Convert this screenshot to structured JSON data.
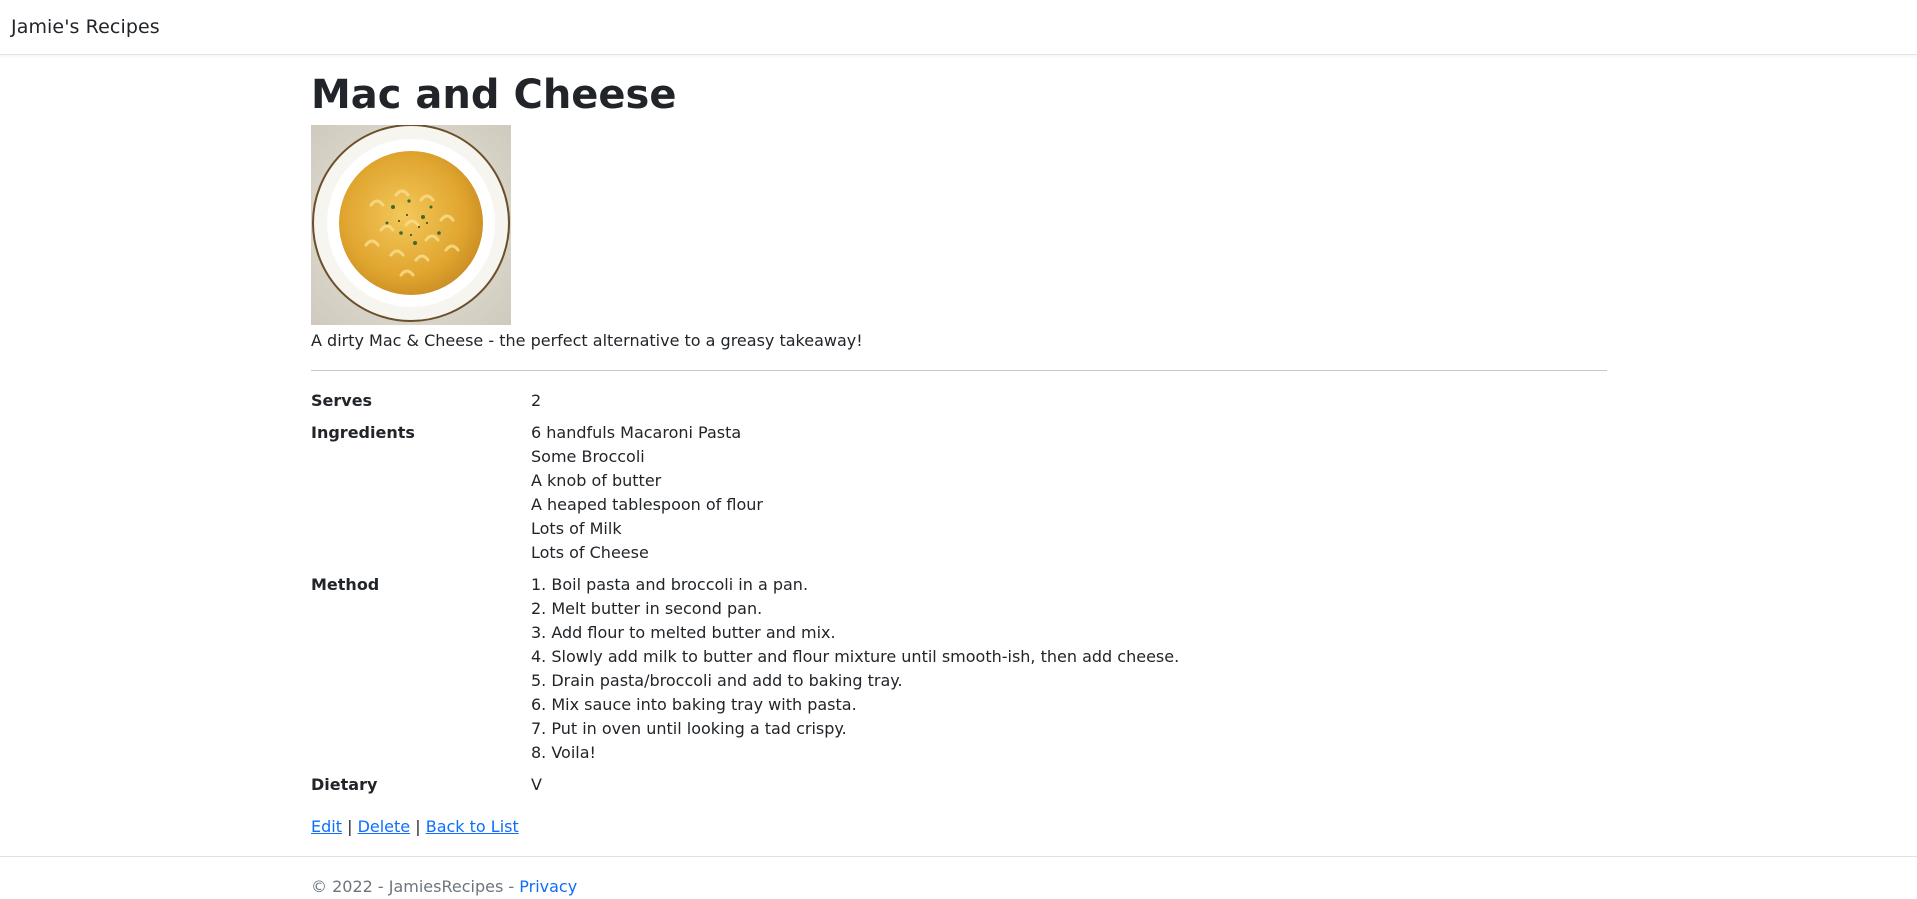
{
  "navbar": {
    "brand": "Jamie's Recipes"
  },
  "recipe": {
    "title": "Mac and Cheese",
    "image_alt": "mac-and-cheese-photo",
    "description": "A dirty Mac & Cheese - the perfect alternative to a greasy takeaway!",
    "serves_label": "Serves",
    "serves_value": "2",
    "ingredients_label": "Ingredients",
    "ingredients": [
      "6 handfuls Macaroni Pasta",
      "Some Broccoli",
      "A knob of butter",
      "A heaped tablespoon of flour",
      "Lots of Milk",
      "Lots of Cheese"
    ],
    "method_label": "Method",
    "method": [
      "1. Boil pasta and broccoli in a pan.",
      "2. Melt butter in second pan.",
      "3. Add flour to melted butter and mix.",
      "4. Slowly add milk to butter and flour mixture until smooth-ish, then add cheese.",
      "5. Drain pasta/broccoli and add to baking tray.",
      "6. Mix sauce into baking tray with pasta.",
      "7. Put in oven until looking a tad crispy.",
      "8. Voila!"
    ],
    "dietary_label": "Dietary",
    "dietary_value": "V"
  },
  "actions": {
    "edit": "Edit",
    "delete": "Delete",
    "back": "Back to List",
    "separator": "|"
  },
  "footer": {
    "copyright": "© 2022 - JamiesRecipes - ",
    "privacy": "Privacy"
  },
  "colors": {
    "link": "#0d6efd",
    "text": "#212529",
    "muted": "#6c757d"
  }
}
